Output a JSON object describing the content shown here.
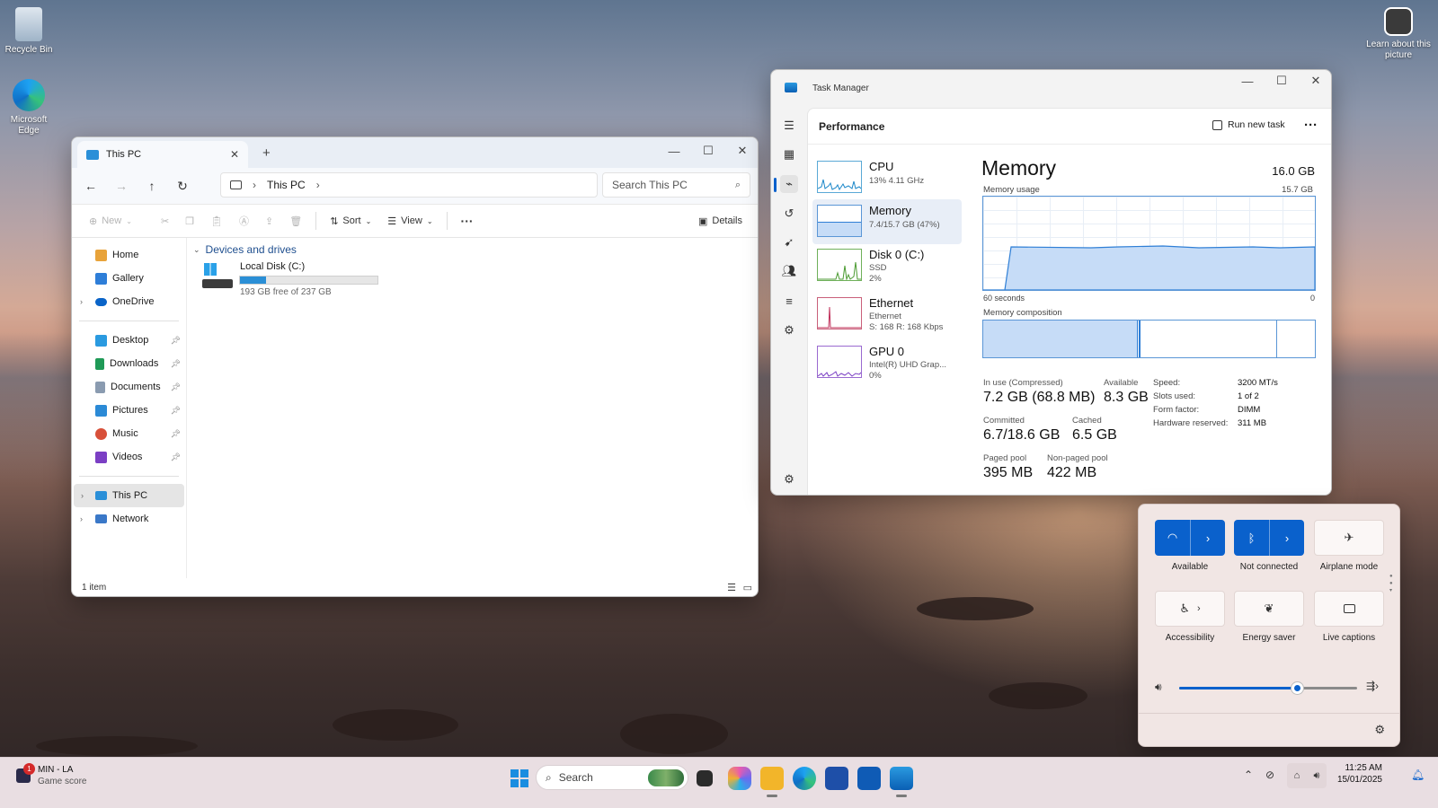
{
  "desktop": {
    "recycle_bin": "Recycle Bin",
    "edge": "Microsoft Edge",
    "learn_about": "Learn about this picture"
  },
  "explorer": {
    "tab_title": "This PC",
    "breadcrumb": "This PC",
    "search_placeholder": "Search This PC",
    "cmd": {
      "new": "New",
      "sort": "Sort",
      "view": "View",
      "details": "Details"
    },
    "nav": {
      "home": "Home",
      "gallery": "Gallery",
      "onedrive": "OneDrive",
      "desktop": "Desktop",
      "downloads": "Downloads",
      "documents": "Documents",
      "pictures": "Pictures",
      "music": "Music",
      "videos": "Videos",
      "this_pc": "This PC",
      "network": "Network"
    },
    "section_title": "Devices and drives",
    "drive": {
      "name": "Local Disk (C:)",
      "free": "193 GB free of 237 GB",
      "used_fraction": 0.19
    },
    "status": "1 item"
  },
  "taskmgr": {
    "title": "Task Manager",
    "page": "Performance",
    "run_task": "Run new task",
    "items": [
      {
        "name": "CPU",
        "sub1": "13% 4.11 GHz",
        "sub2": ""
      },
      {
        "name": "Memory",
        "sub1": "7.4/15.7 GB (47%)",
        "sub2": ""
      },
      {
        "name": "Disk 0 (C:)",
        "sub1": "SSD",
        "sub2": "2%"
      },
      {
        "name": "Ethernet",
        "sub1": "Ethernet",
        "sub2": "S: 168 R: 168 Kbps"
      },
      {
        "name": "GPU 0",
        "sub1": "Intel(R) UHD Grap...",
        "sub2": "0%"
      }
    ],
    "memory": {
      "heading": "Memory",
      "total": "16.0 GB",
      "usage_label": "Memory usage",
      "usage_max": "15.7 GB",
      "time_label": "60 seconds",
      "time_zero": "0",
      "composition_label": "Memory composition",
      "usage_fraction": 0.47,
      "stats": {
        "in_use_label": "In use (Compressed)",
        "in_use": "7.2 GB (68.8 MB)",
        "available_label": "Available",
        "available": "8.3 GB",
        "committed_label": "Committed",
        "committed": "6.7/18.6 GB",
        "cached_label": "Cached",
        "cached": "6.5 GB",
        "paged_label": "Paged pool",
        "paged": "395 MB",
        "nonpaged_label": "Non-paged pool",
        "nonpaged": "422 MB"
      },
      "specs": {
        "speed_label": "Speed:",
        "speed": "3200 MT/s",
        "slots_label": "Slots used:",
        "slots": "1 of 2",
        "form_label": "Form factor:",
        "form": "DIMM",
        "reserved_label": "Hardware reserved:",
        "reserved": "311 MB"
      }
    }
  },
  "quick_settings": {
    "wifi": "Available",
    "bluetooth": "Not connected",
    "airplane": "Airplane mode",
    "accessibility": "Accessibility",
    "energy": "Energy saver",
    "captions": "Live captions",
    "volume_fraction": 0.66
  },
  "taskbar": {
    "game_title": "MIN - LA",
    "game_sub": "Game score",
    "badge": "1",
    "search": "Search",
    "time": "11:25 AM",
    "date": "15/01/2025"
  },
  "colors": {
    "accent": "#0a61cc",
    "memory_fill": "#c6dcf7",
    "memory_line": "#2f7fd6"
  }
}
